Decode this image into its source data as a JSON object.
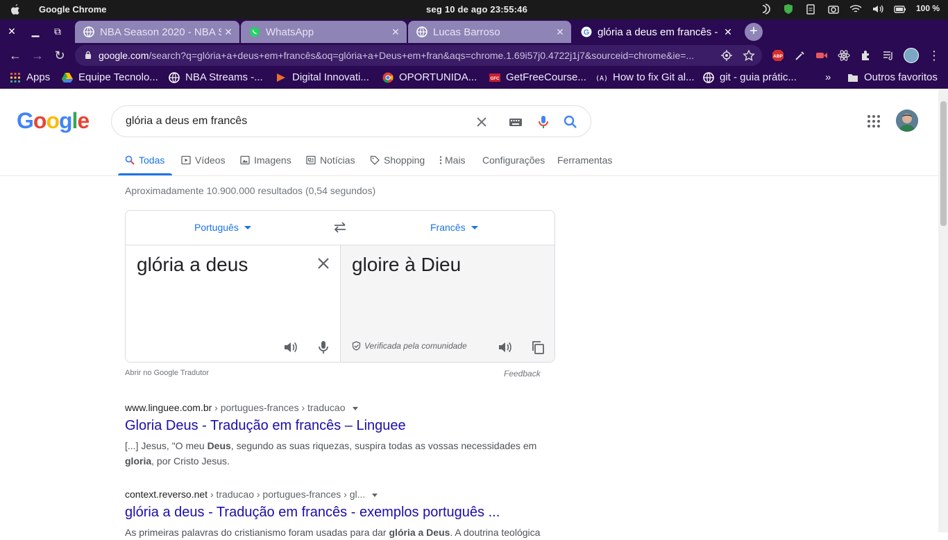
{
  "os": {
    "app_name": "Google Chrome",
    "clock": "seg 10 de ago  23:55:46",
    "battery": "100 %"
  },
  "tabs": [
    {
      "label": "NBA Season 2020 - NBA S",
      "icon": "globe-icon"
    },
    {
      "label": "WhatsApp",
      "icon": "whatsapp-icon"
    },
    {
      "label": "Lucas Barroso",
      "icon": "globe-icon"
    },
    {
      "label": "glória a deus em francês -",
      "icon": "google-icon",
      "active": true
    }
  ],
  "address": {
    "domain": "google.com",
    "rest": "/search?q=glória+a+deus+em+francês&oq=glória+a+Deus+em+fran&aqs=chrome.1.69i57j0.4722j1j7&sourceid=chrome&ie=..."
  },
  "bookmarks": {
    "items": [
      {
        "label": "Apps",
        "icon": "apps-grid-icon"
      },
      {
        "label": "Equipe Tecnolo...",
        "icon": "drive-icon"
      },
      {
        "label": "NBA Streams -...",
        "icon": "globe-icon"
      },
      {
        "label": "Digital Innovati...",
        "icon": "dio-icon"
      },
      {
        "label": "OPORTUNIDA...",
        "icon": "chrome-icon"
      },
      {
        "label": "GetFreeCourse...",
        "icon": "gfc-icon"
      },
      {
        "label": "How to fix Git al...",
        "icon": "dev-icon"
      },
      {
        "label": "git - guia prátic...",
        "icon": "globe-icon"
      }
    ],
    "overflow": "»",
    "other": "Outros favoritos"
  },
  "search": {
    "logo": [
      "G",
      "o",
      "o",
      "g",
      "l",
      "e"
    ],
    "logo_colors": [
      "#4285F4",
      "#EA4335",
      "#FBBC05",
      "#4285F4",
      "#34A853",
      "#EA4335"
    ],
    "query": "glória a deus em francês"
  },
  "nav_tabs": [
    {
      "label": "Todas",
      "selected": true
    },
    {
      "label": "Vídeos"
    },
    {
      "label": "Imagens"
    },
    {
      "label": "Notícias"
    },
    {
      "label": "Shopping"
    },
    {
      "label": "Mais"
    },
    {
      "label": "Configurações"
    },
    {
      "label": "Ferramentas"
    }
  ],
  "result_stats": "Aproximadamente 10.900.000 resultados (0,54 segundos)",
  "translate": {
    "source_lang": "Português",
    "target_lang": "Francês",
    "source_text": "glória a deus",
    "target_text": "gloire à Dieu",
    "verified": "Verificada pela comunidade",
    "open_link": "Abrir no Google Tradutor",
    "feedback": "Feedback"
  },
  "results": [
    {
      "site": "www.linguee.com.br",
      "path": " › portugues-frances › traducao",
      "title": "Gloria Deus - Tradução em francês – Linguee",
      "snippet_parts": [
        "[...] Jesus, \"O meu ",
        "Deus",
        ", segundo as suas riquezas, suspira todas as vossas necessidades em ",
        "gloria",
        ", por Cristo Jesus."
      ]
    },
    {
      "site": "context.reverso.net",
      "path": " › traducao › portugues-frances › gl...",
      "title": "glória a deus - Tradução em francês - exemplos português ...",
      "snippet_parts": [
        "As primeiras palavras do cristianismo foram usadas para dar ",
        "glória a Deus",
        ". A doutrina teológica"
      ]
    }
  ]
}
